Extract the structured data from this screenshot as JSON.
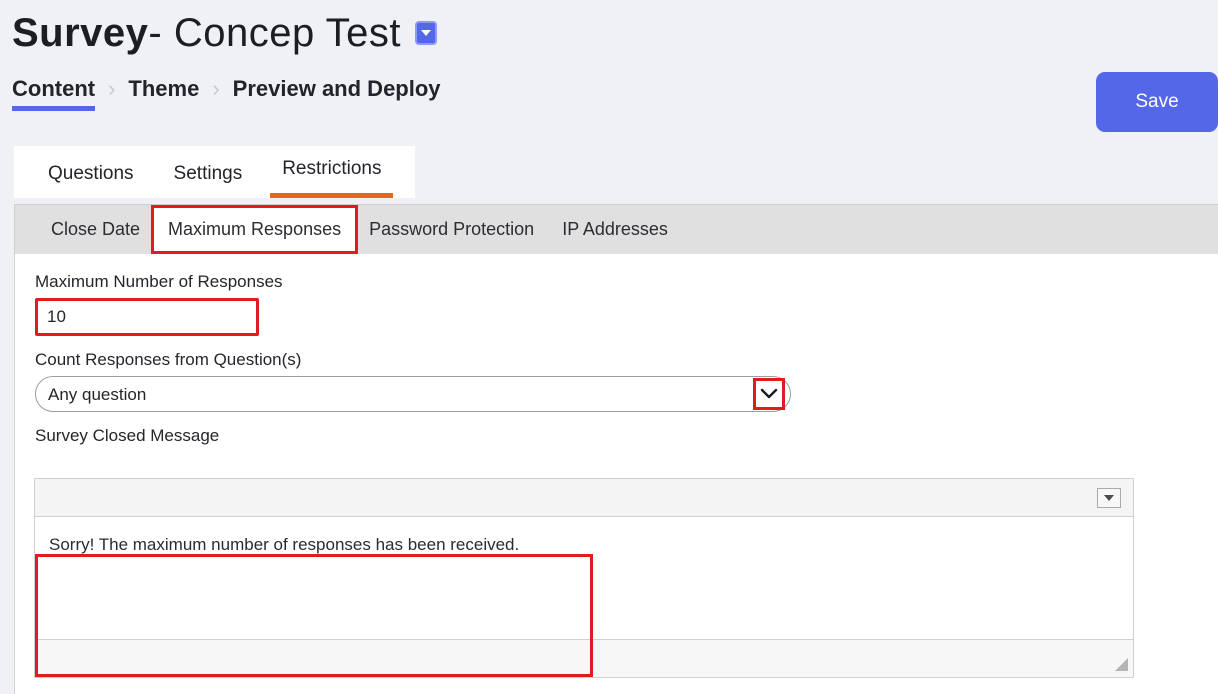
{
  "header": {
    "title_bold": "Survey",
    "title_rest": "- Concep Test",
    "dropdown_icon": "caret-down-icon",
    "save_label": "Save"
  },
  "breadcrumb": {
    "separator": "›",
    "items": [
      {
        "label": "Content",
        "active": true
      },
      {
        "label": "Theme",
        "active": false
      },
      {
        "label": "Preview and Deploy",
        "active": false
      }
    ]
  },
  "main_tabs": [
    {
      "label": "Questions",
      "active": false
    },
    {
      "label": "Settings",
      "active": false
    },
    {
      "label": "Restrictions",
      "active": true
    }
  ],
  "sub_tabs": [
    {
      "label": "Close Date",
      "active": false
    },
    {
      "label": "Maximum Responses",
      "active": true
    },
    {
      "label": "Password Protection",
      "active": false
    },
    {
      "label": "IP Addresses",
      "active": false
    }
  ],
  "form": {
    "max_responses_label": "Maximum Number of Responses",
    "max_responses_value": "10",
    "max_responses_placeholder": "",
    "count_label": "Count Responses from Question(s)",
    "count_selected": "Any question",
    "count_options": [
      "Any question"
    ],
    "count_chevron_icon": "chevron-down-icon",
    "closed_message_label": "Survey Closed Message",
    "closed_message_text": "Sorry! The maximum number of responses has been received.",
    "toolbar_dropdown_icon": "caret-down-icon",
    "resize_grip_icon": "resize-handle-icon"
  },
  "colors": {
    "page_background": "#eff1f5",
    "accent_blue": "#5468e7",
    "accent_orange": "#e8661a",
    "annotation_red": "#e01b22",
    "subtab_background": "#e0e0e0"
  }
}
